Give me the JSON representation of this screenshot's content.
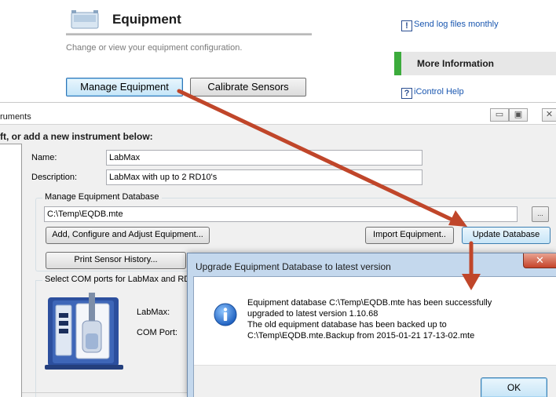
{
  "header": {
    "title": "Equipment",
    "subtitle": "Change or view your equipment configuration.",
    "buttons": {
      "manage": "Manage Equipment",
      "calibrate": "Calibrate Sensors"
    }
  },
  "sidebar": {
    "send_log": "Send log files monthly",
    "more_info": "More Information",
    "help": "iControl Help"
  },
  "instruments_window": {
    "title_fragment": "ruments",
    "instruction_fragment": "ft, or add a new instrument below:",
    "controls": {
      "minimize": "▭",
      "maximize": "▣",
      "close": "✕"
    },
    "name_label": "Name:",
    "name_value": "LabMax",
    "description_label": "Description:",
    "description_value": "LabMax with up to 2 RD10's",
    "db_group_label": "Manage Equipment Database",
    "db_path": "C:\\Temp\\EQDB.mte",
    "browse_label": "...",
    "buttons": {
      "add_config": "Add, Configure and Adjust Equipment...",
      "import": "Import Equipment..",
      "update": "Update Database",
      "print": "Print Sensor History..."
    },
    "com_group_label": "Select COM ports for LabMax and RD",
    "labmax_label": "LabMax:",
    "comport_label": "COM Port:"
  },
  "dialog": {
    "title": "Upgrade Equipment Database to latest version",
    "close": "✕",
    "message_lines": [
      "Equipment database C:\\Temp\\EQDB.mte has been successfully",
      "upgraded to latest version 1.10.68",
      "The old equipment database has been backed up to",
      "C:\\Temp\\EQDB.mte.Backup from 2015-01-21 17-13-02.mte"
    ],
    "ok": "OK"
  },
  "colors": {
    "arrow": "#c0462a",
    "accent_green": "#3cab3c",
    "link_blue": "#1a57b0"
  }
}
